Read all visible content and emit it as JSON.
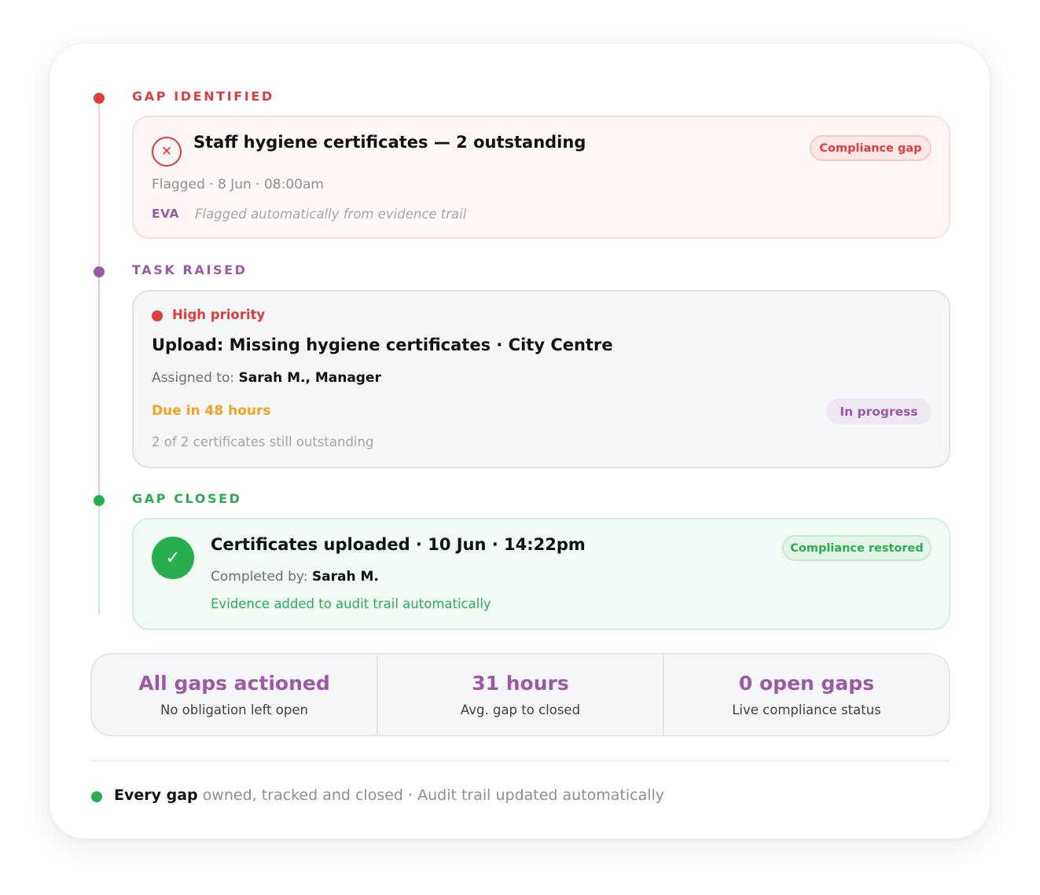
{
  "colors": {
    "gap_red": "#e03c3c",
    "task_purple": "#9a5aa6",
    "closed_green": "#27ae4f",
    "due_orange": "#f3a21c"
  },
  "stages": {
    "gap": {
      "label": "GAP IDENTIFIED",
      "icon": "x-circle-icon",
      "title": "Staff hygiene certificates — 2 outstanding",
      "badge": "Compliance gap",
      "meta": "Flagged · 8 Jun · 08:00am",
      "source": "EVA",
      "note": "Flagged automatically from evidence trail"
    },
    "task": {
      "label": "TASK RAISED",
      "priority": "High priority",
      "title": "Upload: Missing hygiene certificates · City Centre",
      "assigned_prefix": "Assigned to:",
      "assigned_to": "Sarah M., Manager",
      "due": "Due in 48 hours",
      "status": "In progress",
      "outstanding": "2 of 2 certificates still outstanding"
    },
    "closed": {
      "label": "GAP CLOSED",
      "icon": "check-circle-icon",
      "title": "Certificates uploaded · 10 Jun · 14:22pm",
      "badge": "Compliance restored",
      "completed_prefix": "Completed by:",
      "completed_by": "Sarah M.",
      "evidence": "Evidence added to audit trail automatically"
    }
  },
  "stats": [
    {
      "value": "All gaps actioned",
      "label": "No obligation left open"
    },
    {
      "value": "31 hours",
      "label": "Avg. gap to closed"
    },
    {
      "value": "0 open gaps",
      "label": "Live compliance status"
    }
  ],
  "footer": {
    "bold": "Every gap",
    "text": " owned, tracked and closed · Audit trail updated automatically"
  }
}
